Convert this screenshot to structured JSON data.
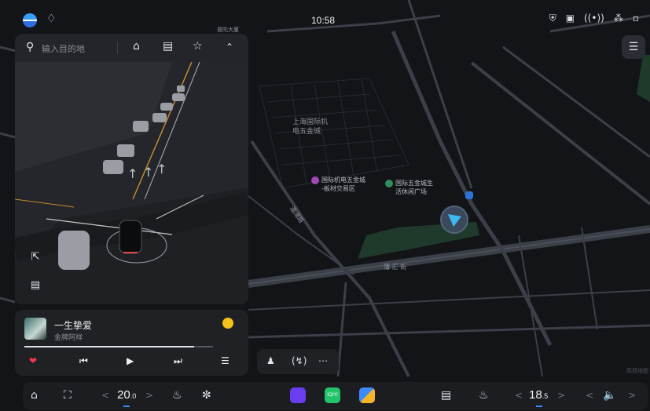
{
  "status": {
    "time": "10:58",
    "icons": [
      "shield-icon",
      "camera-icon",
      "signal-broadcast-icon",
      "bluetooth-icon",
      "cellular-icon"
    ]
  },
  "search": {
    "placeholder": "输入目的地"
  },
  "map": {
    "labels": {
      "area_line1": "上海国际机",
      "area_line2": "电五金城",
      "poi1_line1": "国际机电五金城",
      "poi1_line2": "-板材交易区",
      "poi2_line1": "国际五金城生",
      "poi2_line2": "活休闲广场",
      "road1": "湄浦路",
      "road2": "蒲 汇 街",
      "top_poi": "普陀大厦",
      "watermark": "高德地图"
    },
    "poi_colors": {
      "poi1": "#a246b8",
      "poi2": "#2f8f5a",
      "parking": "#2a73d9"
    }
  },
  "music": {
    "title": "一生挚爱",
    "artist": "金牌阿祥",
    "progress": 0.9,
    "liked": true
  },
  "dock": {
    "left_temp_int": "20",
    "left_temp_dec": ".0",
    "right_temp_int": "18",
    "right_temp_dec": ".5",
    "app_qiyi_label": "iQIYI"
  },
  "colors": {
    "accent": "#3d8bff",
    "like": "#f0384a",
    "nav_arrow": "#3fb8f2"
  }
}
